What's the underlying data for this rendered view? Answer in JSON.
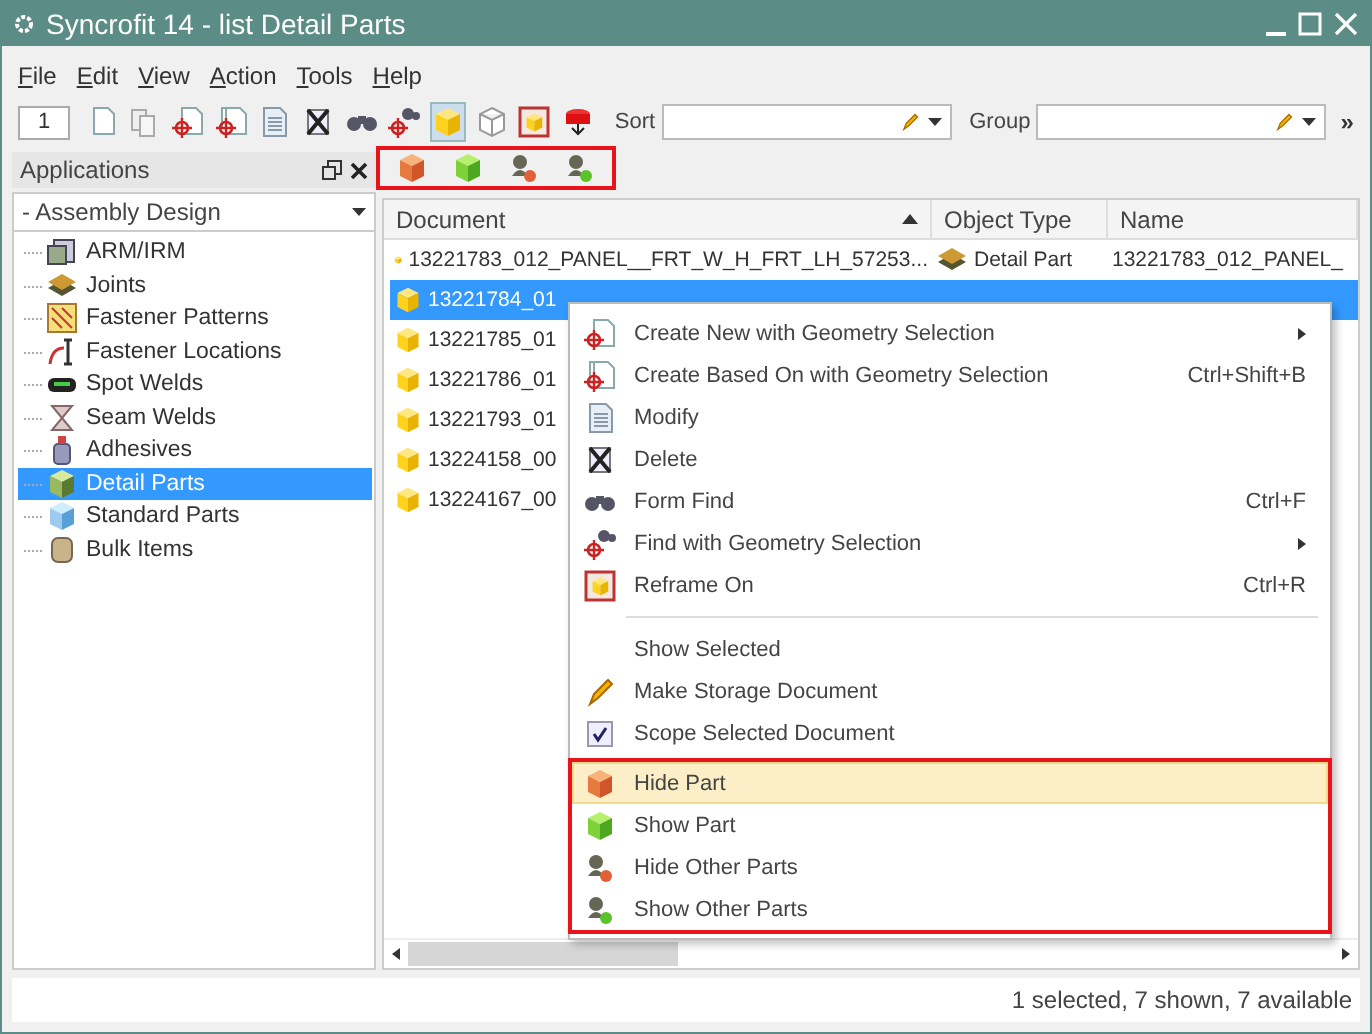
{
  "window": {
    "title": "Syncrofit 14 - list Detail Parts"
  },
  "menu_bar": [
    {
      "label": "File"
    },
    {
      "label": "Edit"
    },
    {
      "label": "View"
    },
    {
      "label": "Action"
    },
    {
      "label": "Tools"
    },
    {
      "label": "Help"
    }
  ],
  "toolbar": {
    "page": "1",
    "tools": [
      {
        "kind": "new-doc",
        "selected": false
      },
      {
        "kind": "copy-doc",
        "selected": false
      },
      {
        "kind": "target-doc",
        "selected": false
      },
      {
        "kind": "target-copy",
        "selected": false
      },
      {
        "kind": "modify",
        "selected": false
      },
      {
        "kind": "delete",
        "selected": false
      },
      {
        "kind": "binoculars",
        "selected": false
      },
      {
        "kind": "find-geometry",
        "selected": false
      },
      {
        "kind": "cube",
        "selected": true
      },
      {
        "kind": "cube-outline",
        "selected": false
      },
      {
        "kind": "reframe",
        "selected": false
      },
      {
        "kind": "export",
        "selected": false
      }
    ],
    "sort_label": "Sort",
    "group_label": "Group",
    "overflow": "»"
  },
  "applications_panel": {
    "title": "Applications",
    "dropdown": "- Assembly Design",
    "items": [
      {
        "label": "ARM/IRM",
        "kind": "arm",
        "selected": false
      },
      {
        "label": "Joints",
        "kind": "joint",
        "selected": false
      },
      {
        "label": "Fastener Patterns",
        "kind": "pattern",
        "selected": false
      },
      {
        "label": "Fastener Locations",
        "kind": "location",
        "selected": false
      },
      {
        "label": "Spot Welds",
        "kind": "spot",
        "selected": false
      },
      {
        "label": "Seam Welds",
        "kind": "seam",
        "selected": false
      },
      {
        "label": "Adhesives",
        "kind": "adhesive",
        "selected": false
      },
      {
        "label": "Detail Parts",
        "kind": "detail",
        "selected": true
      },
      {
        "label": "Standard Parts",
        "kind": "standard",
        "selected": false
      },
      {
        "label": "Bulk Items",
        "kind": "bulk",
        "selected": false
      }
    ]
  },
  "mini_toolbar": {
    "outlined": true,
    "tools": [
      {
        "kind": "hide-part"
      },
      {
        "kind": "show-part"
      },
      {
        "kind": "hide-others"
      },
      {
        "kind": "show-others"
      }
    ]
  },
  "table": {
    "columns": [
      {
        "label": "Document",
        "sorted": true
      },
      {
        "label": "Object Type",
        "sorted": false
      },
      {
        "label": "Name",
        "sorted": false
      }
    ],
    "rows": [
      {
        "document": "13221783_012_PANEL__FRT_W_H_FRT_LH_57253...",
        "object_type": "Detail Part",
        "name": "13221783_012_PANEL_",
        "selected": false
      },
      {
        "document": "13221784_01",
        "selected": true
      },
      {
        "document": "13221785_01",
        "selected": false
      },
      {
        "document": "13221786_01",
        "selected": false
      },
      {
        "document": "13221793_01",
        "selected": false
      },
      {
        "document": "13224158_00",
        "selected": false
      },
      {
        "document": "13224167_00",
        "selected": false
      }
    ]
  },
  "context_menu": {
    "sections": [
      {
        "outlined": false,
        "items": [
          {
            "label": "Create New with Geometry Selection",
            "kind": "target-doc",
            "submenu": true,
            "highlighted": false
          },
          {
            "label": "Create Based On with Geometry Selection",
            "kind": "target-copy",
            "shortcut": "Ctrl+Shift+B",
            "highlighted": false
          },
          {
            "label": "Modify",
            "kind": "modify",
            "highlighted": false
          },
          {
            "label": "Delete",
            "kind": "delete",
            "highlighted": false
          },
          {
            "label": "Form Find",
            "kind": "binoculars",
            "shortcut": "Ctrl+F",
            "highlighted": false
          },
          {
            "label": "Find with Geometry Selection",
            "kind": "find-geometry",
            "submenu": true,
            "highlighted": false
          },
          {
            "label": "Reframe On",
            "kind": "reframe",
            "shortcut": "Ctrl+R",
            "highlighted": false
          }
        ]
      },
      {
        "outlined": false,
        "items": [
          {
            "label": "Show Selected",
            "kind": "plain",
            "highlighted": false
          },
          {
            "label": "Make Storage Document",
            "kind": "pencil",
            "highlighted": false
          },
          {
            "label": "Scope Selected Document",
            "kind": "checkbox",
            "highlighted": false
          }
        ]
      },
      {
        "outlined": true,
        "items": [
          {
            "label": "Hide Part",
            "kind": "hide-part",
            "highlighted": true
          },
          {
            "label": "Show Part",
            "kind": "show-part",
            "highlighted": false
          },
          {
            "label": "Hide Other Parts",
            "kind": "hide-others",
            "highlighted": false
          },
          {
            "label": "Show Other Parts",
            "kind": "show-others",
            "highlighted": false
          }
        ]
      }
    ]
  },
  "status_bar": "1 selected, 7 shown, 7 available"
}
